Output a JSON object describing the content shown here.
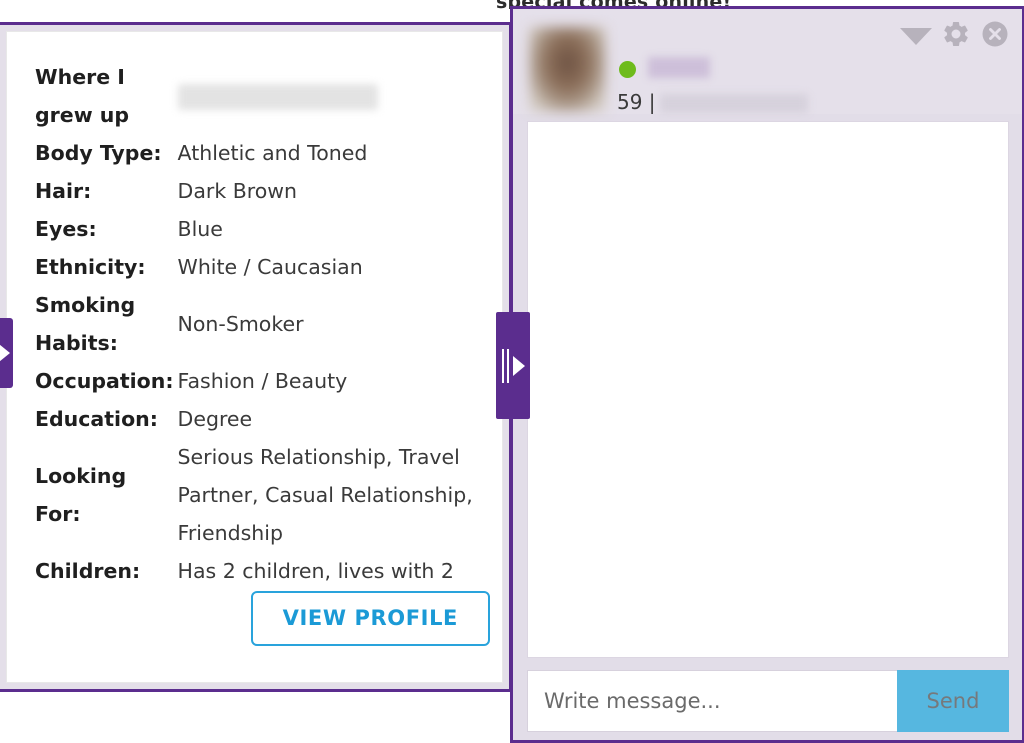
{
  "page": {
    "background_text": "special comes online!"
  },
  "colors": {
    "purple_border": "#5b2d8e",
    "accent_blue": "#29a3dc",
    "send_blue": "#56b7e0",
    "online_green": "#6ebb1c",
    "header_lavender": "#e5e0ea"
  },
  "profile_card": {
    "details": [
      {
        "label": "Where I grew up",
        "value": "",
        "redacted": true
      },
      {
        "label": "Body Type:",
        "value": "Athletic and Toned",
        "redacted": false
      },
      {
        "label": "Hair:",
        "value": "Dark Brown",
        "redacted": false
      },
      {
        "label": "Eyes:",
        "value": "Blue",
        "redacted": false
      },
      {
        "label": "Ethnicity:",
        "value": "White / Caucasian",
        "redacted": false
      },
      {
        "label": "Smoking Habits:",
        "value": "Non-Smoker",
        "redacted": false
      },
      {
        "label": "Occupation:",
        "value": "Fashion / Beauty",
        "redacted": false
      },
      {
        "label": "Education:",
        "value": "Degree",
        "redacted": false
      },
      {
        "label": "Looking For:",
        "value": "Serious Relationship, Travel Partner, Casual Relationship, Friendship",
        "redacted": false
      },
      {
        "label": "Children:",
        "value": "Has 2 children, lives with 2",
        "redacted": false
      }
    ],
    "view_profile_label": "VIEW PROFILE"
  },
  "tabs": {
    "left_tab_icon": "arrow-right-icon",
    "mid_tab_icon": "skip-forward-icon"
  },
  "chat": {
    "user": {
      "name": "",
      "name_redacted": true,
      "online": true,
      "age": "59",
      "separator": "|",
      "location": "",
      "location_redacted": true
    },
    "meta_line": "59 |",
    "controls": {
      "minimize": "chevron-down-icon",
      "settings": "gear-icon",
      "close": "close-icon"
    },
    "input": {
      "placeholder": "Write message...",
      "value": ""
    },
    "send_label": "Send"
  }
}
